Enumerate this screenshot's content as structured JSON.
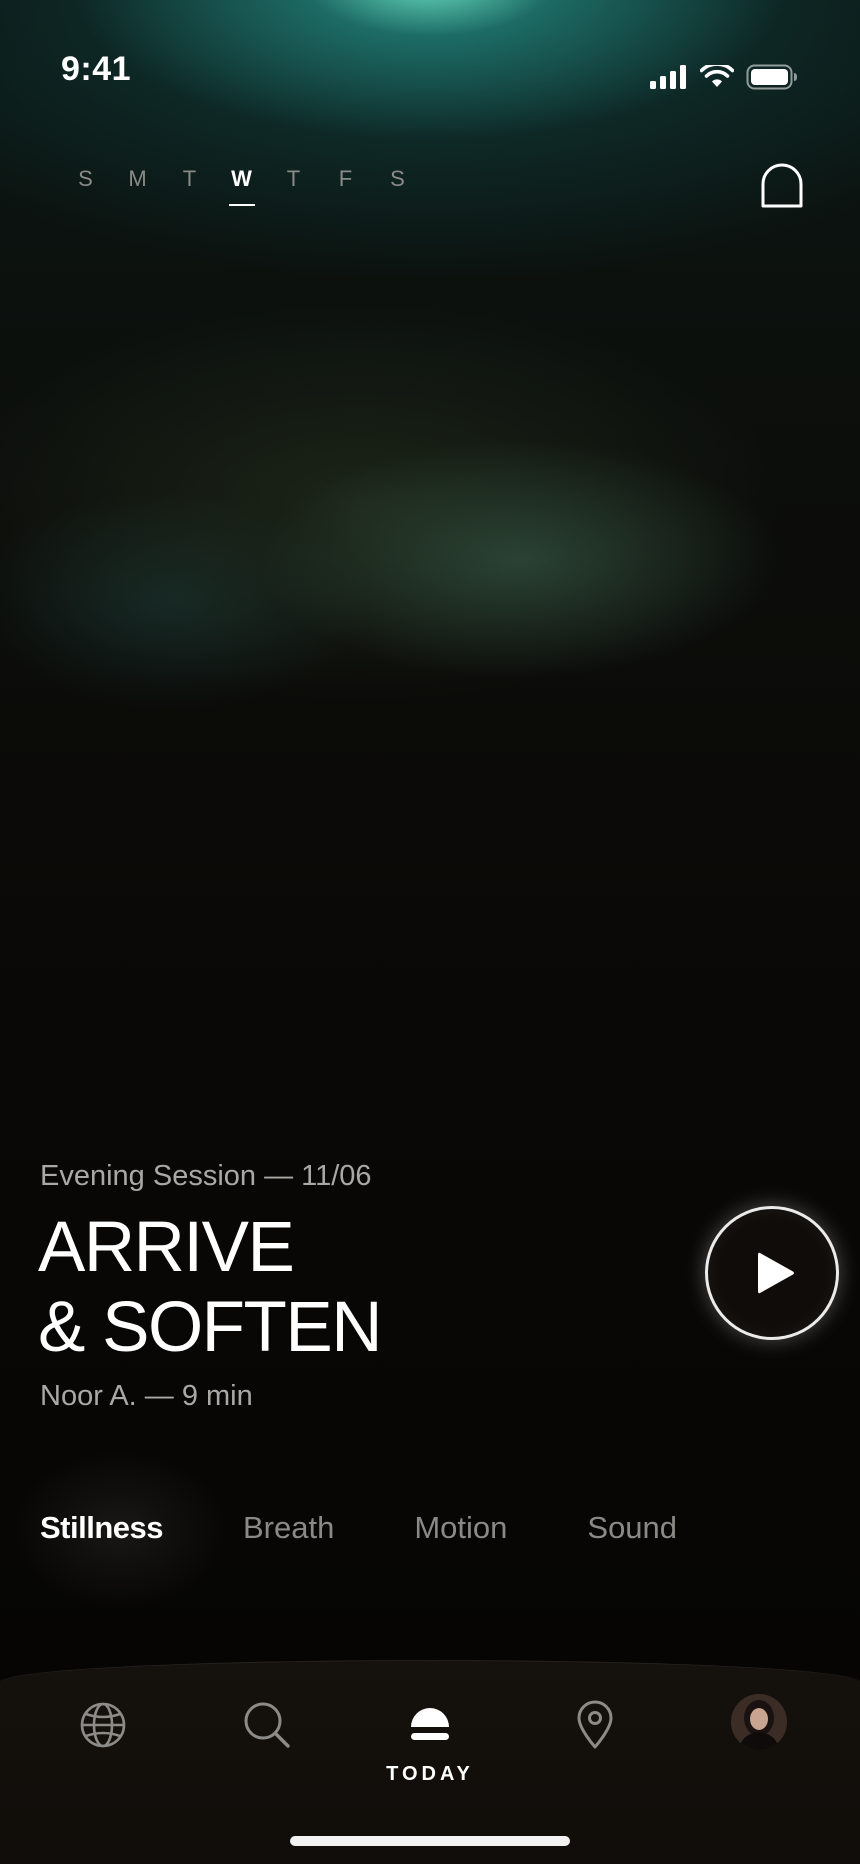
{
  "status_bar": {
    "time": "9:41"
  },
  "week": {
    "days": [
      "S",
      "M",
      "T",
      "W",
      "T",
      "F",
      "S"
    ],
    "selected_index": 3
  },
  "session": {
    "subtitle": "Evening Session — 11/06",
    "title_line1": "ARRIVE",
    "title_line2": "& SOFTEN",
    "meta": "Noor A. — 9 min"
  },
  "tabs": [
    {
      "label": "Stillness",
      "active": true
    },
    {
      "label": "Breath",
      "active": false
    },
    {
      "label": "Motion",
      "active": false
    },
    {
      "label": "Sound",
      "active": false
    }
  ],
  "nav": {
    "items": [
      {
        "icon": "globe-icon"
      },
      {
        "icon": "search-icon"
      },
      {
        "icon": "today-icon",
        "label": "TODAY",
        "active": true
      },
      {
        "icon": "location-pin-icon"
      },
      {
        "icon": "avatar"
      }
    ]
  },
  "colors": {
    "accent_glow": "#6ee6c8",
    "text_primary": "#ffffff",
    "text_secondary": "#a9a8a4",
    "background": "#060504"
  }
}
